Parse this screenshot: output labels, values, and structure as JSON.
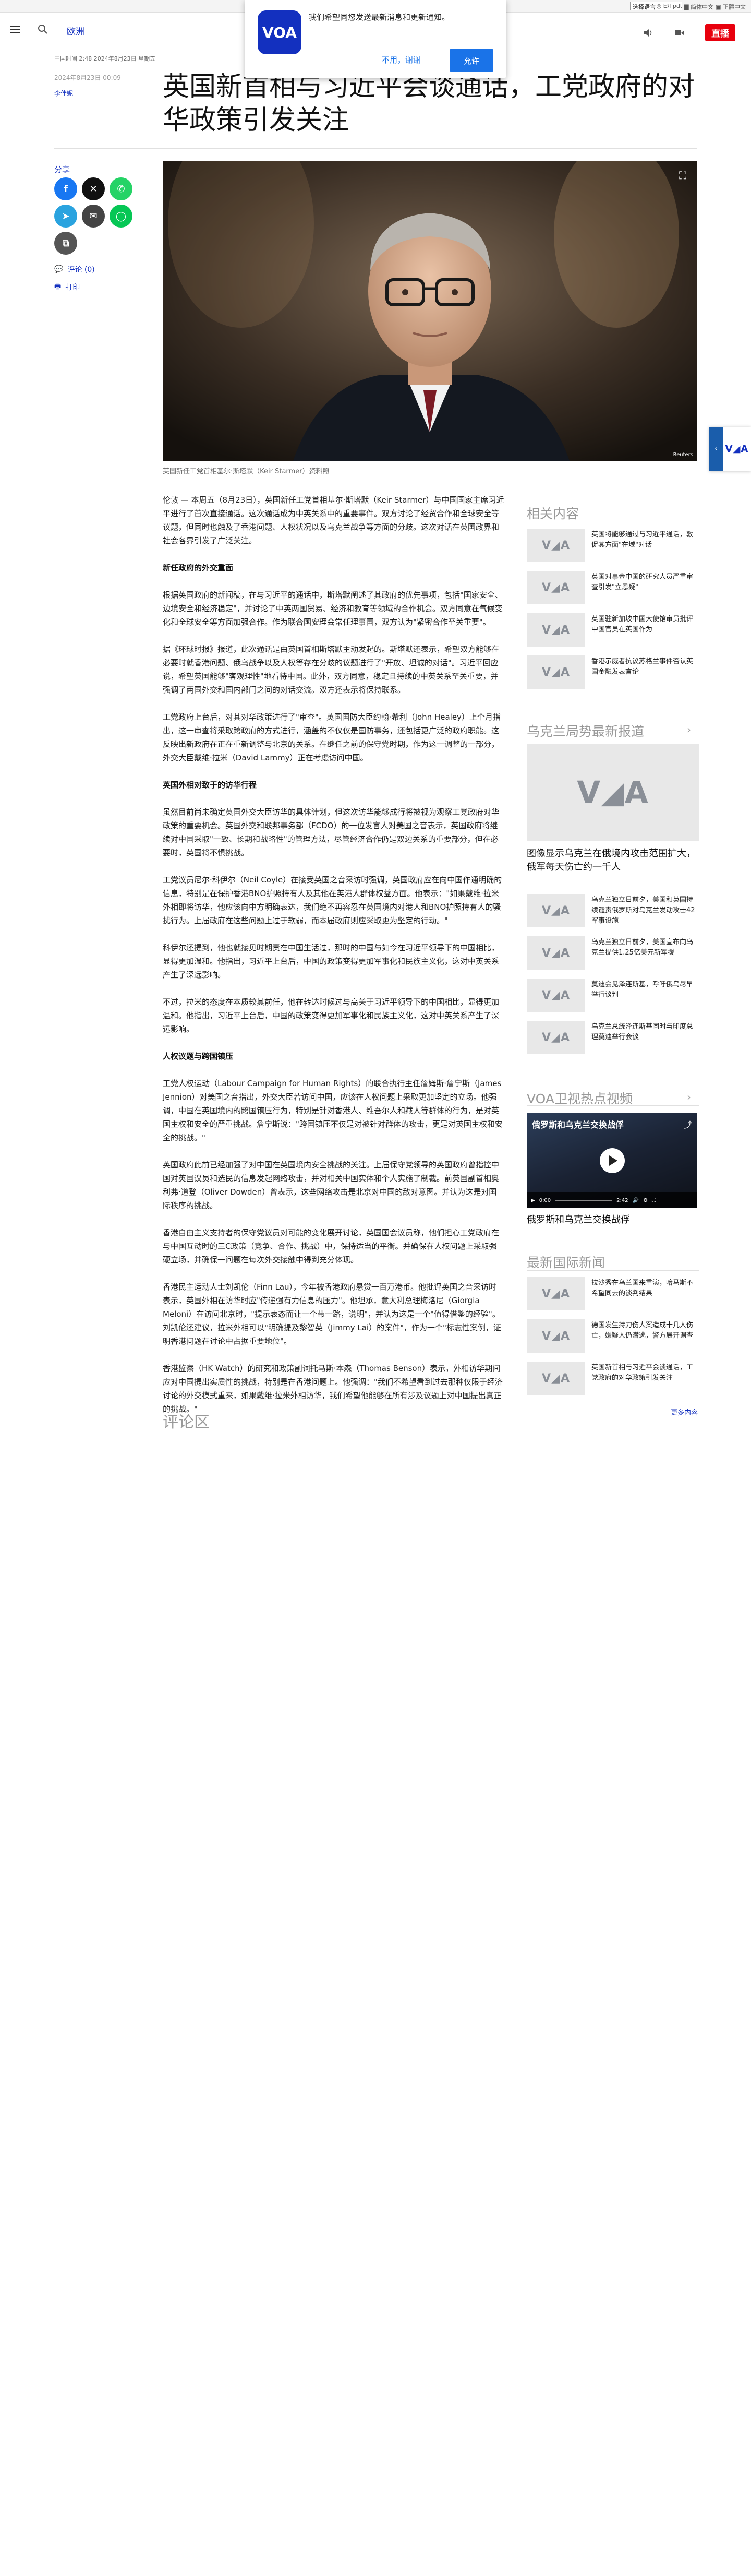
{
  "utility": {
    "language_select": "选择语言",
    "links": [
      "◎ ЕЯ pdt",
      "▇ 简体中文",
      "▣ 正體中文"
    ]
  },
  "header": {
    "section": "欧洲",
    "live_label": "直播"
  },
  "notification": {
    "message": "我们希望同您发送最新消息和更新通知。",
    "deny": "不用，谢谢",
    "allow": "允许",
    "logo_text": "VOA"
  },
  "article": {
    "meta": "中国时间 2:48 2024年8月23日 星期五",
    "date": "2024年8月23日 00:09",
    "author": "李佳妮",
    "headline": "英国新首相与习近平会谈通话，工党政府的对华政策引发关注",
    "caption": "英国新任工党首相基尔·斯塔默（Keir Starmer）资料照",
    "image_credit": "Reuters"
  },
  "share": {
    "label": "分享",
    "comments_link": "评论 (0)",
    "print_link": "打印"
  },
  "body": [
    {
      "type": "p",
      "text": "伦敦 — 本周五（8月23日），英国新任工党首相基尔·斯塔默（Keir Starmer）与中国国家主席习近平进行了首次直接通话。这次通话成为中英关系中的重要事件。双方讨论了经贸合作和全球安全等议题，但同时也触及了香港问题、人权状况以及乌克兰战争等方面的分歧。这次对话在英国政界和社会各界引发了广泛关注。"
    },
    {
      "type": "h",
      "text": "新任政府的外交重面"
    },
    {
      "type": "p",
      "text": "根据英国政府的新闻稿，在与习近平的通话中，斯塔默阐述了其政府的优先事项，包括\"国家安全、边境安全和经济稳定\"，并讨论了中英两国贸易、经济和教育等领域的合作机会。双方同意在气候变化和全球安全等方面加强合作。作为联合国安理会常任理事国，双方认为\"紧密合作至关重要\"。"
    },
    {
      "type": "p",
      "text": "据《环球时报》报道，此次通话是由英国首相斯塔默主动发起的。斯塔默还表示，希望双方能够在必要时就香港问题、俄乌战争以及人权等存在分歧的议题进行了\"开放、坦诚的对话\"。习近平回应说，希望英国能够\"客观理性\"地看待中国。此外，双方同意，稳定且持续的中英关系至关重要，并强调了两国外交和国内部门之间的对话交流。双方还表示将保持联系。"
    },
    {
      "type": "p",
      "text": "工党政府上台后，对其对华政策进行了\"审查\"。英国国防大臣约翰·希利（John Healey）上个月指出，这一审查将采取跨政府的方式进行，涵盖的不仅仅是国防事务，还包括更广泛的政府职能。这反映出新政府在正在重新调整与北京的关系。在继任之前的保守党时期，作为这一调整的一部分，外交大臣戴维·拉米（David Lammy）正在考虑访问中国。"
    },
    {
      "type": "h",
      "text": "英国外相对致于的访华行程"
    },
    {
      "type": "p",
      "text": "虽然目前尚未确定英国外交大臣访华的具体计划，但这次访华能够成行将被视为观察工党政府对华政策的重要机会。英国外交和联邦事务部（FCDO）的一位发言人对美国之音表示，英国政府将继续对中国采取\"一致、长期和战略性\"的管理方法，尽管经济合作仍是双边关系的重要部分，但在必要时，英国将不惧挑战。"
    },
    {
      "type": "p",
      "text": "工党议员尼尔·科伊尔（Neil Coyle）在接受英国之音采访时强调，英国政府应在向中国作通明确的信息，特别是在保护香港BNO护照持有人及其他在英港人群体权益方面。他表示：\"如果戴维·拉米外相即将访华，他应该向中方明确表达，我们绝不再容忍在英国境内对港人和BNO护照持有人的骚扰行为。上届政府在这些问题上过于软弱，而本届政府则应采取更为坚定的行动。\""
    },
    {
      "type": "p",
      "text": "科伊尔还提到，他也就接见时期责在中国生活过，那时的中国与如今在习近平领导下的中国相比，显得更加温和。他指出，习近平上台后，中国的政策变得更加军事化和民族主义化，这对中英关系产生了深远影响。"
    },
    {
      "type": "p",
      "text": "不过，拉米的态度在本质较其前任，他在转达时候过与高关于习近平领导下的中国相比，显得更加温和。他指出，习近平上台后，中国的政策变得更加军事化和民族主义化，这对中英关系产生了深远影响。"
    },
    {
      "type": "h",
      "text": "人权议题与跨国镇压"
    },
    {
      "type": "p",
      "text": "工党人权运动（Labour Campaign for Human Rights）的联合执行主任詹姆斯·詹宁斯（James Jennion）对美国之音指出，外交大臣若访问中国，应该在人权问题上采取更加坚定的立场。他强调，中国在英国境内的跨国镇压行为，特别是针对香港人、维吾尔人和藏人等群体的行为，是对英国主权和安全的严重挑战。詹宁斯说：\"跨国镇压不仅是对被针对群体的攻击，更是对英国主权和安全的挑战。\""
    },
    {
      "type": "p",
      "text": "英国政府此前已经加强了对中国在英国境内安全挑战的关注。上届保守党领导的英国政府曾指控中国对英国议员和选民的信息发起网络攻击，并对相关中国实体和个人实施了制裁。前英国副首相奥利弗·道登（Oliver Dowden）曾表示，这些网络攻击是北京对中国的敌对意图。并认为这是对国际秩序的挑战。"
    },
    {
      "type": "p",
      "text": "香港自由主义支持者的保守党议员对可能的变化展开讨论，英国国会议员称，他们担心工党政府在与中国互动时的三C政策（竞争、合作、挑战）中，保持适当的平衡。并确保在人权问题上采取强硬立场，并确保一问题在每次外交接触中得到充分体现。"
    },
    {
      "type": "p",
      "text": "香港民主运动人士刘凯伦（Finn Lau），今年被香港政府悬赏一百万港币。他批评英国之音采访时表示，英国外相在访华时应\"传递强有力信息的压力\"。他坦承，意大利总理梅洛尼（Giorgia Meloni）在访问北京时，\"提示表态而让一个带一路，说明\"，并认为这是一个\"值得借鉴的经验\"。刘凯伦还建议，拉米外相可以\"明确提及黎智英（Jimmy Lai）的案件\"，作为一个\"标志性案例，证明香港问题在讨论中占据重要地位\"。"
    },
    {
      "type": "p",
      "text": "香港监察（HK Watch）的研究和政策副词托马斯·本森（Thomas Benson）表示，外相访华期间应对中国提出实质性的挑战，特别是在香港问题上。他强调：\"我们不希望看到过去那种仅限于经济讨论的外交模式重来，如果戴维·拉米外相访华，我们希望他能够在所有涉及议题上对中国提出真正的挑战。\""
    }
  ],
  "comments": {
    "title": "评论区"
  },
  "rail": {
    "related_title": "相关内容",
    "related": [
      "英国将能够通过与习近平通话，敦促其方面\"在域\"对话",
      "英国对事金中国的研究人员严重审查引发\"立恩疑\"",
      "英国驻新加坡中国大使馆审员批评中国官员在英国作为",
      "香港示威者抗议苏格兰事件否认英国金融发表言论"
    ],
    "ukraine_title": "乌克兰局势最新报道",
    "ukraine_featured": "图像显示乌克兰在俄境内攻击范围扩大，俄军每天伤亡约一千人",
    "ukraine": [
      "乌克兰独立日前夕，美国和英国持续谴责俄罗斯对乌克兰发动攻击42军事设施",
      "乌克兰独立日前夕，美国宣布向乌克兰提供1.25亿美元新军援",
      "莫迪会见泽连斯基，呼吁俄乌尽早举行谈判",
      "乌克兰总统泽连斯基同时与印度总理莫迪举行会谈"
    ],
    "video_title": "VOA卫视热点视频",
    "video": {
      "overlay_title": "俄罗斯和乌克兰交换战俘",
      "caption": "俄罗斯和乌克兰交换战俘",
      "time_current": "0:00",
      "time_total": "2:42",
      "progress": 0
    },
    "intl_title": "最新国际新闻",
    "intl": [
      "拉沙秀在乌兰国来重演，哈马斯不希望同去的谈判结果",
      "德国发生持刀伤人案造成十几人伤亡，嫌疑人仍潜逃，警方展开调查",
      "英国新首相与习近平会谈通话，工党政府的对华政策引发关注"
    ],
    "more": "更多内容"
  },
  "colors": {
    "brand": "#1330bf",
    "live": "#e8000d",
    "notification_button": "#1a73e8",
    "facebook": "#1877f2",
    "x": "#111111",
    "whatsapp": "#25d366",
    "telegram": "#2aa3df",
    "email": "#444444",
    "line": "#06c755",
    "copy": "#555555"
  }
}
